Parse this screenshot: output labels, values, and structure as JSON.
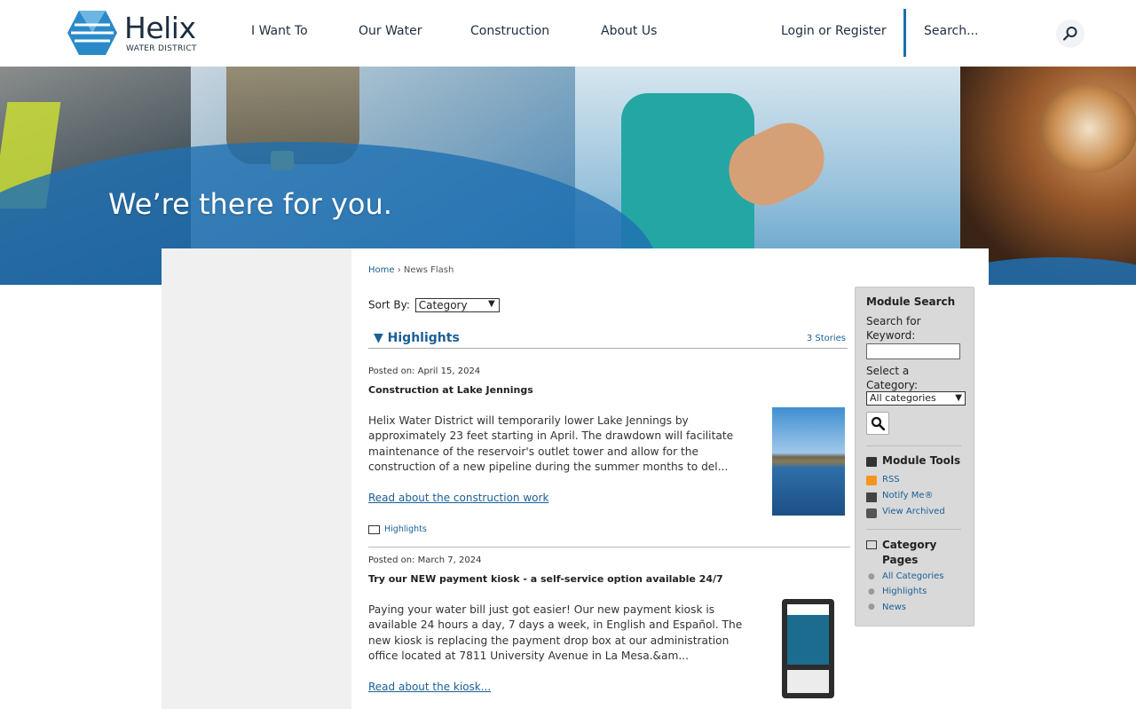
{
  "header": {
    "logo_name": "Helix",
    "logo_sub": "WATER DISTRICT",
    "nav": [
      "I Want To",
      "Our Water",
      "Construction",
      "About Us"
    ],
    "login": "Login or Register",
    "search_placeholder": "Search..."
  },
  "banner": {
    "tagline": "We’re there for you."
  },
  "breadcrumb": {
    "home": "Home",
    "sep": "›",
    "current": "News Flash"
  },
  "sort": {
    "label": "Sort By:",
    "value": "Category"
  },
  "section": {
    "title": "Highlights",
    "count": "3 Stories"
  },
  "news": [
    {
      "posted": "Posted on: April 15, 2024",
      "title": "Construction at Lake Jennings",
      "body": "Helix Water District will temporarily lower Lake Jennings by approximately 23 feet starting in April. The drawdown will facilitate maintenance of the reservoir's outlet tower and allow for the construction of a new pipeline during the summer months to del...",
      "link": "Read about the construction work",
      "category": "Highlights"
    },
    {
      "posted": "Posted on: March 7, 2024",
      "title": "Try our NEW payment kiosk - a self-service option available 24/7",
      "body": "Paying your water bill just got easier! Our new payment kiosk is available 24 hours a day, 7 days a week, in English and Español. The new kiosk is replacing the payment drop box at our administration office located at 7811 University Avenue in La Mesa.&am...",
      "link": "Read about the kiosk..."
    }
  ],
  "module": {
    "search_title": "Module Search",
    "keyword_label": "Search for Keyword:",
    "category_label": "Select a Category:",
    "category_value": "All categories",
    "tools_title": "Module Tools",
    "tools": [
      "RSS",
      "Notify Me®",
      "View Archived"
    ],
    "pages_title": "Category Pages",
    "pages": [
      "All Categories",
      "Highlights",
      "News"
    ]
  }
}
